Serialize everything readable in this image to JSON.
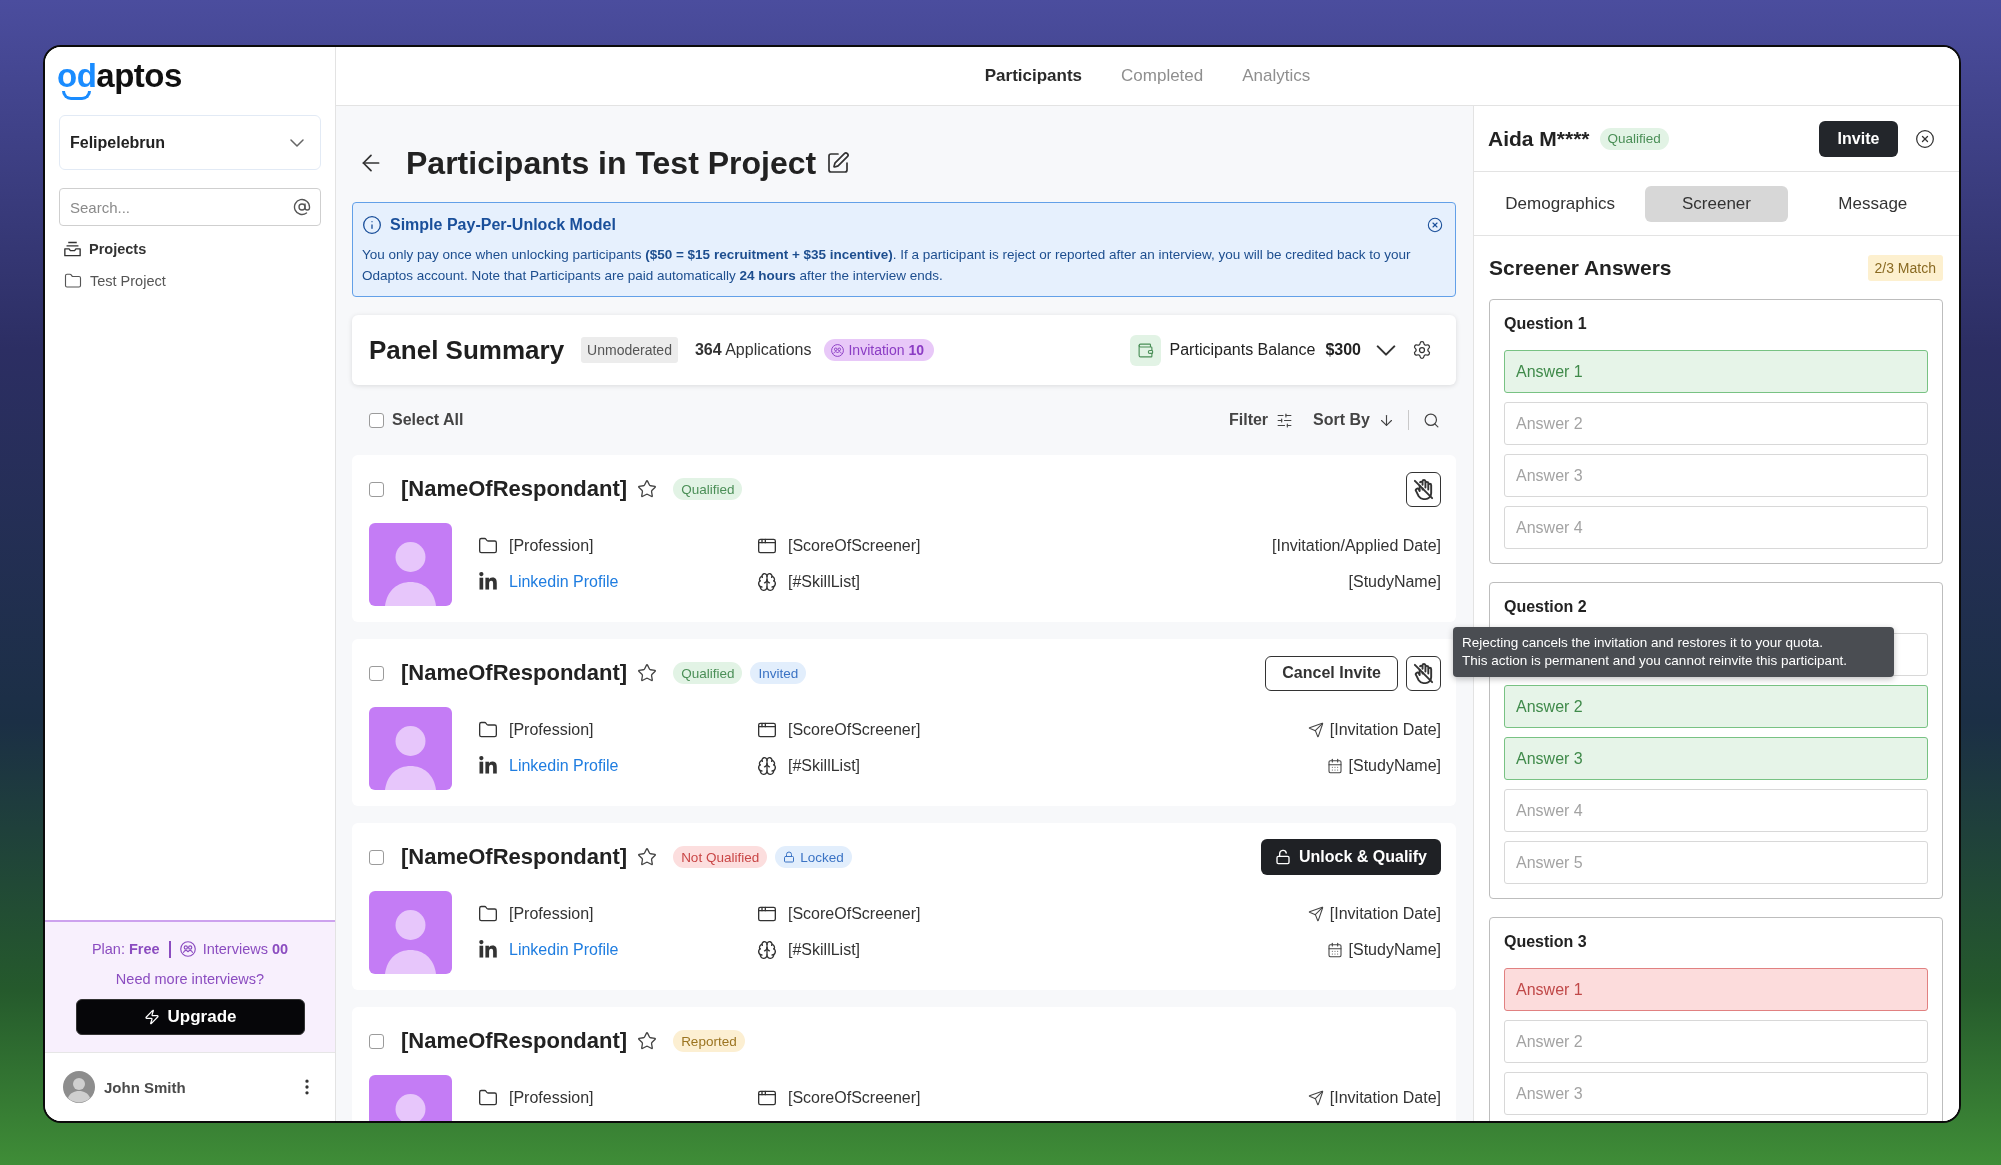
{
  "logo": {
    "accent": "od",
    "text": "aptos"
  },
  "sidebar": {
    "workspace": "Felipelebrun",
    "search": {
      "placeholder": "Search..."
    },
    "items": [
      {
        "label": "Projects",
        "kind": "section"
      },
      {
        "label": "Test Project",
        "kind": "project"
      }
    ]
  },
  "plan": {
    "plan": "Plan: **Free**",
    "interviews": "Interviews **00**",
    "prompt": "Need more interviews?",
    "button": "Upgrade"
  },
  "user": {
    "name": "John Smith"
  },
  "nav_tabs": [
    {
      "label": "Participants",
      "selected": true
    },
    {
      "label": "Completed",
      "selected": false
    },
    {
      "label": "Analytics",
      "selected": false
    }
  ],
  "page_title": "Participants in Test Project",
  "banner": {
    "title": "Simple Pay-Per-Unlock Model",
    "text": "You only pay once when unlocking participants **($50 = $15 recruitment + $35 incentive)**. If a participant is reject or reported after an interview, you will be credited back to your Odaptos account. Note that Participants are paid automatically **24 hours** after the interview ends."
  },
  "panel_summary": {
    "title": "Panel Summary",
    "mode": "Unmoderated",
    "applications": "**364** Applications",
    "invitations": "Invitation **10**",
    "balance_label": "Participants Balance",
    "balance": "$300"
  },
  "toolbar": {
    "select_all": {
      "label": "Select All",
      "checked": false
    },
    "filter": "Filter",
    "sort": "Sort By"
  },
  "participants": [
    {
      "name": "[NameOfRespondant]",
      "checked": false,
      "starred": false,
      "badges": [
        {
          "label": "Qualified",
          "kind": "qualified"
        }
      ],
      "actions": [
        {
          "kind": "reject"
        }
      ],
      "profile": [
        {
          "kind": "profession",
          "text": "[Profession]"
        },
        {
          "kind": "linkedin",
          "text": "Linkedin Profile"
        }
      ],
      "screener": [
        {
          "kind": "score",
          "text": "[ScoreOfScreener]"
        },
        {
          "kind": "skills",
          "text": "[#SkillList]"
        }
      ],
      "schedule": [
        {
          "kind": "date",
          "with_icon": false,
          "text": "[Invitation/Applied Date]"
        },
        {
          "kind": "study",
          "with_icon": false,
          "text": "[StudyName]"
        }
      ]
    },
    {
      "name": "[NameOfRespondant]",
      "checked": false,
      "starred": false,
      "badges": [
        {
          "label": "Qualified",
          "kind": "qualified"
        },
        {
          "label": "Invited",
          "kind": "invited"
        }
      ],
      "actions": [
        {
          "kind": "outline",
          "label": "Cancel Invite"
        },
        {
          "kind": "reject"
        }
      ],
      "profile": [
        {
          "kind": "profession",
          "text": "[Profession]"
        },
        {
          "kind": "linkedin",
          "text": "Linkedin Profile"
        }
      ],
      "screener": [
        {
          "kind": "score",
          "text": "[ScoreOfScreener]"
        },
        {
          "kind": "skills",
          "text": "[#SkillList]"
        }
      ],
      "schedule": [
        {
          "kind": "date",
          "with_icon": true,
          "text": "[Invitation Date]"
        },
        {
          "kind": "study",
          "with_icon": true,
          "text": "[StudyName]"
        }
      ]
    },
    {
      "name": "[NameOfRespondant]",
      "checked": false,
      "starred": false,
      "badges": [
        {
          "label": "Not Qualified",
          "kind": "not_qualified"
        },
        {
          "label": "Locked",
          "kind": "locked"
        }
      ],
      "actions": [
        {
          "kind": "unlock",
          "label": "Unlock & Qualify"
        }
      ],
      "profile": [
        {
          "kind": "profession",
          "text": "[Profession]"
        },
        {
          "kind": "linkedin",
          "text": "Linkedin Profile"
        }
      ],
      "screener": [
        {
          "kind": "score",
          "text": "[ScoreOfScreener]"
        },
        {
          "kind": "skills",
          "text": "[#SkillList]"
        }
      ],
      "schedule": [
        {
          "kind": "date",
          "with_icon": true,
          "text": "[Invitation Date]"
        },
        {
          "kind": "study",
          "with_icon": true,
          "text": "[StudyName]"
        }
      ]
    },
    {
      "name": "[NameOfRespondant]",
      "checked": false,
      "starred": false,
      "badges": [
        {
          "label": "Reported",
          "kind": "reported"
        }
      ],
      "profile": [
        {
          "kind": "profession",
          "text": "[Profession]"
        }
      ],
      "screener": [
        {
          "kind": "score",
          "text": "[ScoreOfScreener]"
        }
      ],
      "schedule": [
        {
          "kind": "date",
          "with_icon": true,
          "text": "[Invitation Date]"
        }
      ]
    }
  ],
  "tooltip": {
    "text": "Rejecting cancels the invitation and restores it to your quota.\nThis action is permanent and you cannot reinvite this participant."
  },
  "detail_panel": {
    "name": "Aida M****",
    "badge": {
      "label": "Qualified",
      "kind": "qualified"
    },
    "invite": "Invite",
    "tabs": [
      {
        "label": "Demographics",
        "selected": false
      },
      {
        "label": "Screener",
        "selected": true
      },
      {
        "label": "Message",
        "selected": false
      }
    ],
    "title": "Screener Answers",
    "match": "2/3 Match",
    "questions": [
      {
        "title": "Question 1",
        "answers": [
          {
            "label": "Answer 1",
            "kind": "match"
          },
          {
            "label": "Answer 2",
            "kind": "plain"
          },
          {
            "label": "Answer 3",
            "kind": "plain"
          },
          {
            "label": "Answer 4",
            "kind": "plain"
          }
        ]
      },
      {
        "title": "Question 2",
        "answers": [
          {
            "kind": "plain"
          },
          {
            "label": "Answer 2",
            "kind": "match"
          },
          {
            "label": "Answer 3",
            "kind": "match"
          },
          {
            "label": "Answer 4",
            "kind": "plain"
          },
          {
            "label": "Answer 5",
            "kind": "plain"
          }
        ]
      },
      {
        "title": "Question 3",
        "answers": [
          {
            "label": "Answer 1",
            "kind": "mismatch"
          },
          {
            "label": "Answer 2",
            "kind": "plain"
          },
          {
            "label": "Answer 3",
            "kind": "plain"
          }
        ]
      }
    ]
  }
}
